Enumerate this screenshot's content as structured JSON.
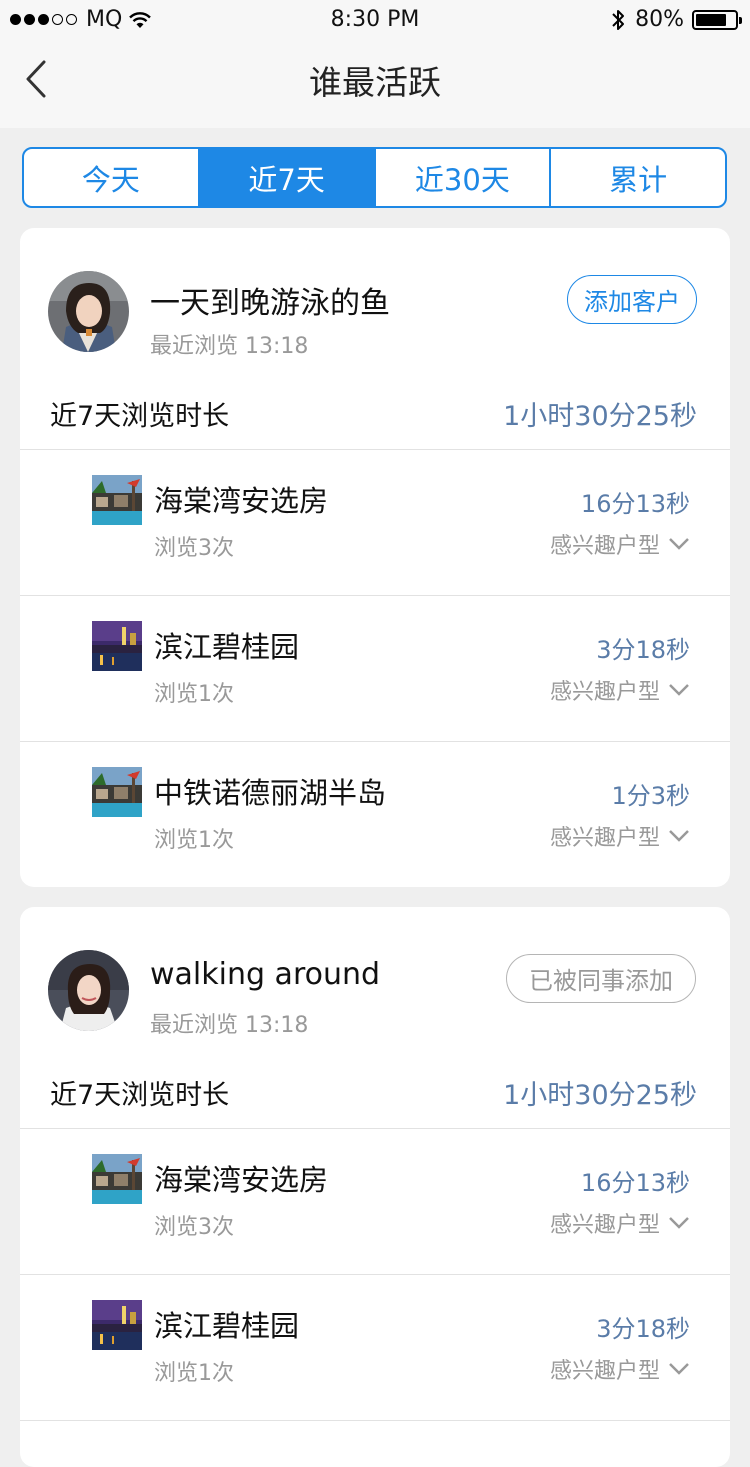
{
  "status_bar": {
    "carrier": "MQ",
    "time": "8:30 PM",
    "battery": "80%",
    "battery_level": 0.8
  },
  "nav": {
    "title": "谁最活跃"
  },
  "tabs": [
    {
      "label": "今天"
    },
    {
      "label": "近7天"
    },
    {
      "label": "近30天"
    },
    {
      "label": "累计"
    }
  ],
  "active_tab": "近7天",
  "customers": [
    {
      "name": "一天到晚游泳的鱼",
      "recent": "最近浏览 13:18",
      "action": "添加客户",
      "duration_label": "近7天浏览时长",
      "duration": "1小时30分25秒",
      "properties": [
        {
          "name": "海棠湾安选房",
          "views": "浏览3次",
          "time": "16分13秒",
          "interest": "感兴趣户型"
        },
        {
          "name": "滨江碧桂园",
          "views": "浏览1次",
          "time": "3分18秒",
          "interest": "感兴趣户型"
        },
        {
          "name": "中铁诺德丽湖半岛",
          "views": "浏览1次",
          "time": "1分3秒",
          "interest": "感兴趣户型"
        }
      ]
    },
    {
      "name": "walking around",
      "recent": "最近浏览 13:18",
      "action": "已被同事添加",
      "duration_label": "近7天浏览时长",
      "duration": "1小时30分25秒",
      "properties": [
        {
          "name": "海棠湾安选房",
          "views": "浏览3次",
          "time": "16分13秒",
          "interest": "感兴趣户型"
        },
        {
          "name": "滨江碧桂园",
          "views": "浏览1次",
          "time": "3分18秒",
          "interest": "感兴趣户型"
        }
      ]
    }
  ],
  "colors": {
    "accent": "#1e88e5",
    "duration": "#5a7ca8",
    "muted": "#999999",
    "background": "#efefef"
  }
}
